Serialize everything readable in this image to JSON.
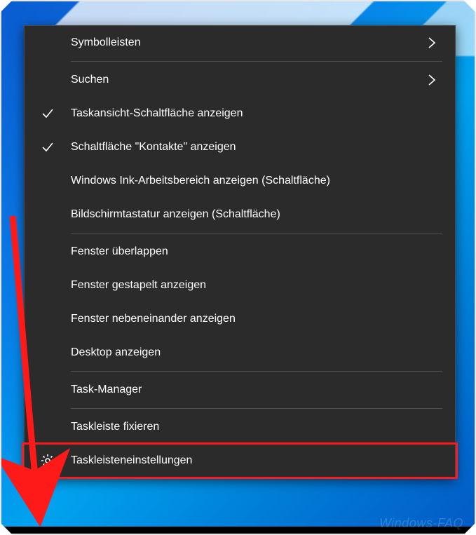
{
  "menu": {
    "items": [
      {
        "label": "Symbolleisten",
        "submenu": true
      },
      {
        "separator": true
      },
      {
        "label": "Suchen",
        "submenu": true
      },
      {
        "label": "Taskansicht-Schaltfläche anzeigen",
        "checked": true
      },
      {
        "label": "Schaltfläche \"Kontakte\" anzeigen",
        "checked": true
      },
      {
        "label": "Windows Ink-Arbeitsbereich anzeigen (Schaltfläche)"
      },
      {
        "label": "Bildschirmtastatur anzeigen (Schaltfläche)"
      },
      {
        "separator": true
      },
      {
        "label": "Fenster überlappen"
      },
      {
        "label": "Fenster gestapelt anzeigen"
      },
      {
        "label": "Fenster nebeneinander anzeigen"
      },
      {
        "label": "Desktop anzeigen"
      },
      {
        "separator": true
      },
      {
        "label": "Task-Manager"
      },
      {
        "separator": true
      },
      {
        "label": "Taskleiste fixieren"
      },
      {
        "label": "Taskleisteneinstellungen",
        "icon": "gear",
        "highlighted": true
      }
    ]
  },
  "watermark": "Windows-FAQ"
}
